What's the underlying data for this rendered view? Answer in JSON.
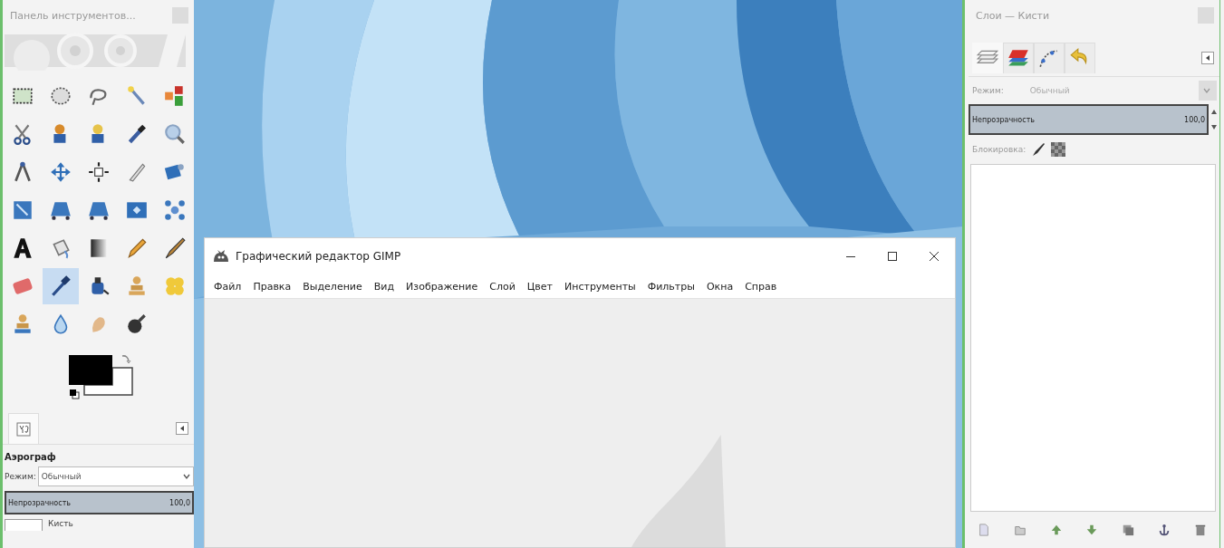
{
  "toolbox": {
    "title": "Панель инструментов...",
    "tools": [
      {
        "selected": false
      },
      {
        "selected": false
      },
      {
        "selected": false
      },
      {
        "selected": false
      },
      {
        "selected": false
      },
      {
        "selected": false
      },
      {
        "selected": false
      },
      {
        "selected": false
      },
      {
        "selected": false
      },
      {
        "selected": false
      },
      {
        "selected": false
      },
      {
        "selected": false
      },
      {
        "selected": false
      },
      {
        "selected": false
      },
      {
        "selected": false
      },
      {
        "selected": false
      },
      {
        "selected": false
      },
      {
        "selected": false
      },
      {
        "selected": false
      },
      {
        "selected": false
      },
      {
        "selected": false
      },
      {
        "selected": false
      },
      {
        "selected": false
      },
      {
        "selected": false
      },
      {
        "selected": false
      },
      {
        "selected": false
      },
      {
        "selected": true
      },
      {
        "selected": false
      },
      {
        "selected": false
      },
      {
        "selected": false
      },
      {
        "selected": false
      },
      {
        "selected": false
      },
      {
        "selected": false
      },
      {
        "selected": false
      }
    ],
    "options": {
      "tool_name": "Аэрограф",
      "mode_label": "Режим:",
      "mode_value": "Обычный",
      "opacity_label": "Непрозрачность",
      "opacity_value": "100,0",
      "level": 1.0,
      "brush_label": "Кисть"
    }
  },
  "main_window": {
    "title": "Графический редактор GIMP",
    "menu": [
      "Файл",
      "Правка",
      "Выделение",
      "Вид",
      "Изображение",
      "Слой",
      "Цвет",
      "Инструменты",
      "Фильтры",
      "Окна",
      "Справ"
    ]
  },
  "dock": {
    "title": "Слои — Кисти",
    "tabs": [
      {
        "selected": true
      },
      {
        "selected": false
      },
      {
        "selected": false
      },
      {
        "selected": false
      }
    ],
    "mode_label": "Режим:",
    "mode_value": "Обычный",
    "mode_disabled": true,
    "opacity_label": "Непрозрачность",
    "opacity_value": "100,0",
    "level": 1.0,
    "lock_label": "Блокировка:"
  }
}
